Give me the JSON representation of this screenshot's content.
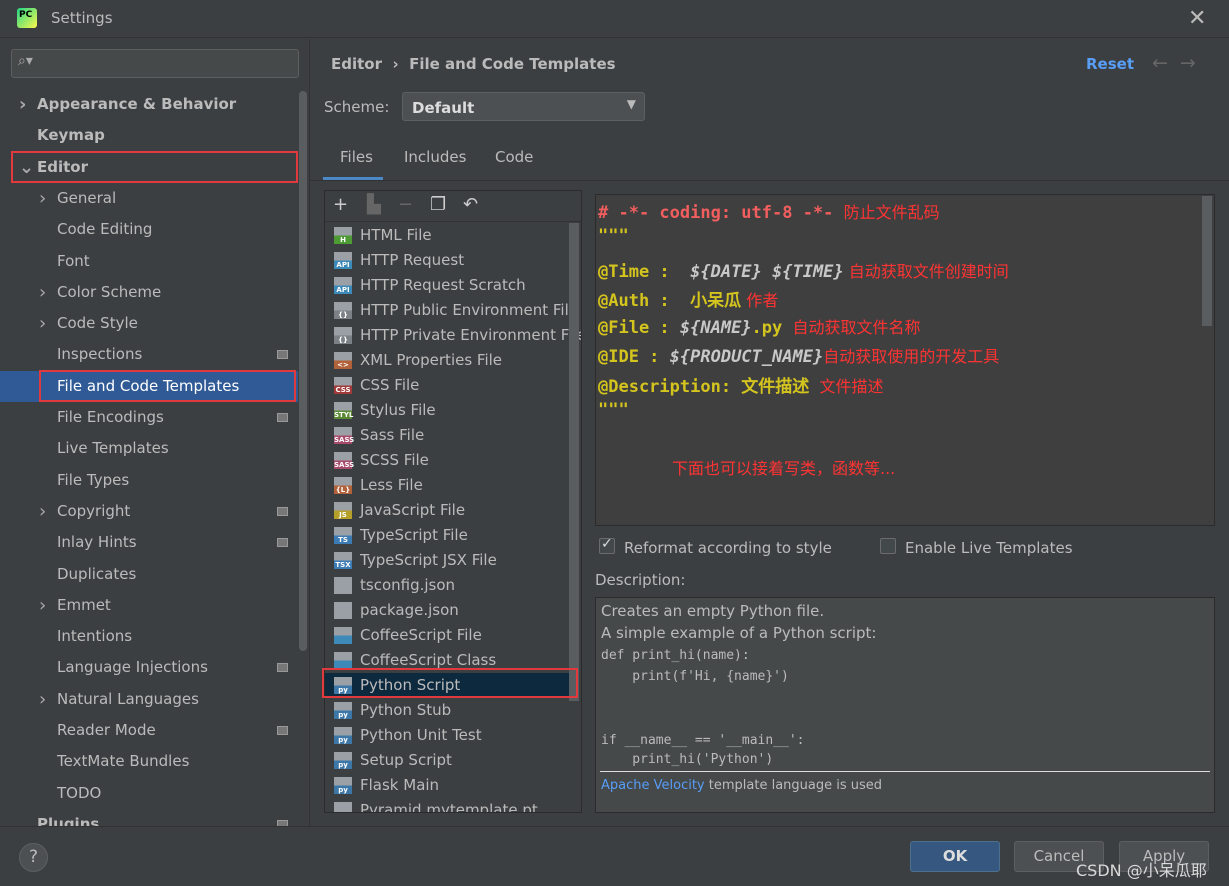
{
  "window": {
    "title": "Settings",
    "logo": "PC",
    "close_icon": "close-icon"
  },
  "sidebar": {
    "search_placeholder": "",
    "items": [
      {
        "label": "Appearance & Behavior",
        "chev": true,
        "level": 0,
        "bold": true
      },
      {
        "label": "Keymap",
        "level": 0,
        "bold": true
      },
      {
        "label": "Editor",
        "chev": true,
        "open": true,
        "level": 0,
        "bold": true,
        "highlight": true
      },
      {
        "label": "General",
        "chev": true,
        "level": 1
      },
      {
        "label": "Code Editing",
        "level": 1
      },
      {
        "label": "Font",
        "level": 1
      },
      {
        "label": "Color Scheme",
        "chev": true,
        "level": 1
      },
      {
        "label": "Code Style",
        "chev": true,
        "level": 1
      },
      {
        "label": "Inspections",
        "level": 1,
        "badge": true
      },
      {
        "label": "File and Code Templates",
        "level": 1,
        "selected": true,
        "highlight": true
      },
      {
        "label": "File Encodings",
        "level": 1,
        "badge": true
      },
      {
        "label": "Live Templates",
        "level": 1
      },
      {
        "label": "File Types",
        "level": 1
      },
      {
        "label": "Copyright",
        "chev": true,
        "level": 1,
        "badge": true
      },
      {
        "label": "Inlay Hints",
        "level": 1,
        "badge": true
      },
      {
        "label": "Duplicates",
        "level": 1
      },
      {
        "label": "Emmet",
        "chev": true,
        "level": 1
      },
      {
        "label": "Intentions",
        "level": 1
      },
      {
        "label": "Language Injections",
        "level": 1,
        "badge": true
      },
      {
        "label": "Natural Languages",
        "chev": true,
        "level": 1
      },
      {
        "label": "Reader Mode",
        "level": 1,
        "badge": true
      },
      {
        "label": "TextMate Bundles",
        "level": 1
      },
      {
        "label": "TODO",
        "level": 1
      },
      {
        "label": "Plugins",
        "level": 0,
        "bold": true,
        "badge": true
      }
    ]
  },
  "header": {
    "breadcrumb": [
      "Editor",
      "File and Code Templates"
    ],
    "separator": "›",
    "reset": "Reset"
  },
  "scheme": {
    "label": "Scheme:",
    "value": "Default"
  },
  "tabs": [
    "Files",
    "Includes",
    "Code"
  ],
  "active_tab": "Files",
  "files": [
    {
      "label": "HTML File",
      "icon": "H",
      "color": "#4e9a35"
    },
    {
      "label": "HTTP Request",
      "icon": "API",
      "color": "#3d8ab8"
    },
    {
      "label": "HTTP Request Scratch",
      "icon": "API",
      "color": "#3d8ab8"
    },
    {
      "label": "HTTP Public Environment File",
      "icon": "{}",
      "color": "#7b8186"
    },
    {
      "label": "HTTP Private Environment File",
      "icon": "{}",
      "color": "#7b8186"
    },
    {
      "label": "XML Properties File",
      "icon": "<>",
      "color": "#b1623a"
    },
    {
      "label": "CSS File",
      "icon": "CSS",
      "color": "#a33a3a"
    },
    {
      "label": "Stylus File",
      "icon": "STYL",
      "color": "#5c8a34"
    },
    {
      "label": "Sass File",
      "icon": "SASS",
      "color": "#a84a6a"
    },
    {
      "label": "SCSS File",
      "icon": "SASS",
      "color": "#a84a6a"
    },
    {
      "label": "Less File",
      "icon": "{L}",
      "color": "#b1623a"
    },
    {
      "label": "JavaScript File",
      "icon": "JS",
      "color": "#b5a128"
    },
    {
      "label": "TypeScript File",
      "icon": "TS",
      "color": "#3d7bb5"
    },
    {
      "label": "TypeScript JSX File",
      "icon": "TSX",
      "color": "#3d7bb5"
    },
    {
      "label": "tsconfig.json",
      "icon": "",
      "color": "#9aa0a6"
    },
    {
      "label": "package.json",
      "icon": "",
      "color": "#9aa0a6"
    },
    {
      "label": "CoffeeScript File",
      "icon": "",
      "color": "#3d8ab8"
    },
    {
      "label": "CoffeeScript Class",
      "icon": "",
      "color": "#3d8ab8"
    },
    {
      "label": "Python Script",
      "icon": "py",
      "color": "#3c77a8",
      "selected": true
    },
    {
      "label": "Python Stub",
      "icon": "py",
      "color": "#3c77a8"
    },
    {
      "label": "Python Unit Test",
      "icon": "py",
      "color": "#3c77a8"
    },
    {
      "label": "Setup Script",
      "icon": "py",
      "color": "#3c77a8"
    },
    {
      "label": "Flask Main",
      "icon": "py",
      "color": "#3c77a8"
    },
    {
      "label": "Pyramid mytemplate.pt",
      "icon": "",
      "color": "#9aa0a6"
    }
  ],
  "editor": {
    "lines": [
      {
        "parts": [
          {
            "t": "# -*- coding: utf-8 -*-",
            "c": "red"
          },
          {
            "t": "  防止文件乱码",
            "c": "ann"
          }
        ]
      },
      {
        "parts": [
          {
            "t": "\"\"\"",
            "c": "kw"
          }
        ]
      },
      {
        "parts": [
          {
            "t": "@Time :  ",
            "c": "kw"
          },
          {
            "t": "${DATE} ${TIME}",
            "c": "var"
          },
          {
            "t": " 自动获取文件创建时间",
            "c": "ann"
          }
        ]
      },
      {
        "parts": [
          {
            "t": "@Auth :  ",
            "c": "kw"
          },
          {
            "t": "小呆瓜",
            "c": "kw"
          },
          {
            "t": " 作者",
            "c": "ann"
          }
        ]
      },
      {
        "parts": [
          {
            "t": "@File : ",
            "c": "kw"
          },
          {
            "t": "${NAME}",
            "c": "var"
          },
          {
            "t": ".py",
            "c": "kw"
          },
          {
            "t": "  自动获取文件名称",
            "c": "ann"
          }
        ]
      },
      {
        "parts": [
          {
            "t": "@IDE : ",
            "c": "kw"
          },
          {
            "t": "${PRODUCT_NAME}",
            "c": "var"
          },
          {
            "t": "自动获取使用的开发工具",
            "c": "ann"
          }
        ]
      },
      {
        "parts": [
          {
            "t": "@Description: 文件描述",
            "c": "kw"
          },
          {
            "t": "  文件描述",
            "c": "ann"
          }
        ]
      },
      {
        "parts": [
          {
            "t": "\"\"\"",
            "c": "kw"
          }
        ]
      }
    ],
    "note": "下面也可以接着写类，函数等..."
  },
  "options": {
    "reformat": {
      "label": "Reformat according to style",
      "checked": true
    },
    "live": {
      "label": "Enable Live Templates",
      "checked": false
    }
  },
  "description": {
    "label": "Description:",
    "lines": [
      "Creates an empty Python file.",
      "A simple example of a Python script:"
    ],
    "code": [
      "def print_hi(name):",
      "    print(f'Hi, {name}')",
      "if __name__ == '__main__':",
      "    print_hi('Python')"
    ],
    "link": "Apache Velocity",
    "suffix": " template language is used"
  },
  "footer": {
    "help": "?",
    "ok": "OK",
    "cancel": "Cancel",
    "apply": "Apply"
  },
  "watermark": "CSDN @小呆瓜耶",
  "colors": {
    "accent": "#589df6",
    "selection": "#2f5a95",
    "highlight_box": "#e0393e",
    "annotation": "#ff3333"
  }
}
